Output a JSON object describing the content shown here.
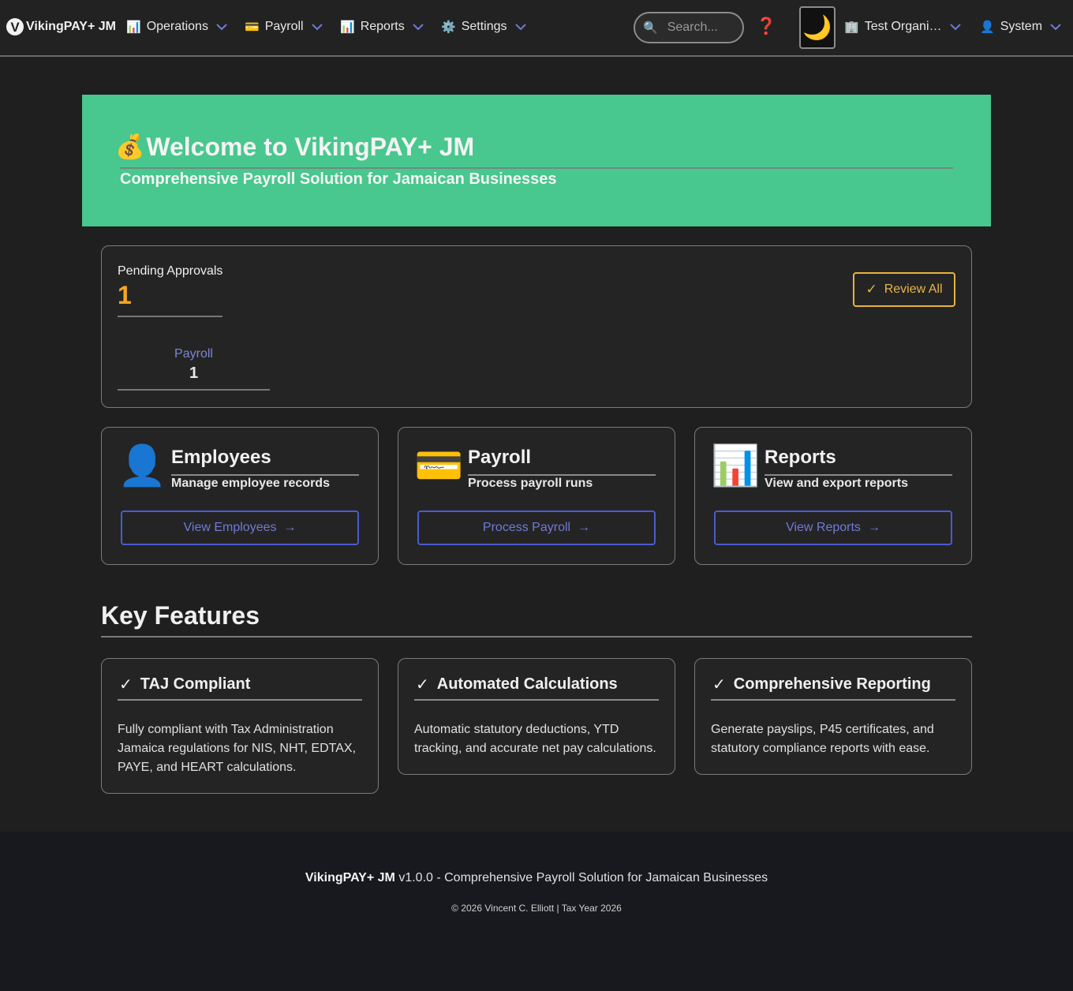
{
  "navbar": {
    "brand_logo": "V",
    "brand": "VikingPAY+ JM",
    "menus": [
      {
        "emoji": "📊",
        "label": "Operations"
      },
      {
        "emoji": "💳",
        "label": "Payroll"
      },
      {
        "emoji": "📊",
        "label": "Reports"
      },
      {
        "emoji": "⚙️",
        "label": "Settings"
      }
    ],
    "search_icon": "🔍",
    "search_placeholder": "Search...",
    "help_icon": "❓",
    "theme_icon": "🌙",
    "org": {
      "emoji": "🏢",
      "label": "Test Organi…"
    },
    "user": {
      "emoji": "👤",
      "label": "System"
    },
    "chevron_color": "#6f7ad8"
  },
  "hero": {
    "emoji": "💰",
    "title": "Welcome to VikingPAY+ JM",
    "subtitle": "Comprehensive Payroll Solution for Jamaican Businesses",
    "bg_color": "#48c78e"
  },
  "pending": {
    "label": "Pending Approvals",
    "count": "1",
    "category": "Payroll",
    "category_count": "1",
    "review_icon": "✓",
    "review_label": "Review All",
    "accent_color": "#f5a623"
  },
  "quick_cards": [
    {
      "icon": "👤",
      "title": "Employees",
      "subtitle": "Manage employee records",
      "button": "View Employees",
      "arrow": "→"
    },
    {
      "icon": "💳",
      "title": "Payroll",
      "subtitle": "Process payroll runs",
      "button": "Process Payroll",
      "arrow": "→"
    },
    {
      "icon": "📊",
      "title": "Reports",
      "subtitle": "View and export reports",
      "button": "View Reports",
      "arrow": "→"
    }
  ],
  "features": {
    "title": "Key Features",
    "items": [
      {
        "check": "✓",
        "title": "TAJ Compliant",
        "desc": "Fully compliant with Tax Administration Jamaica regulations for NIS, NHT, EDTAX, PAYE, and HEART calculations."
      },
      {
        "check": "✓",
        "title": "Automated Calculations",
        "desc": "Automatic statutory deductions, YTD tracking, and accurate net pay calculations."
      },
      {
        "check": "✓",
        "title": "Comprehensive Reporting",
        "desc": "Generate payslips, P45 certificates, and statutory compliance reports with ease."
      }
    ]
  },
  "footer": {
    "brand": "VikingPAY+ JM",
    "tagline": " v1.0.0 - Comprehensive Payroll Solution for Jamaican Businesses",
    "copyright": "© 2026 Vincent C. Elliott | Tax Year 2026"
  }
}
